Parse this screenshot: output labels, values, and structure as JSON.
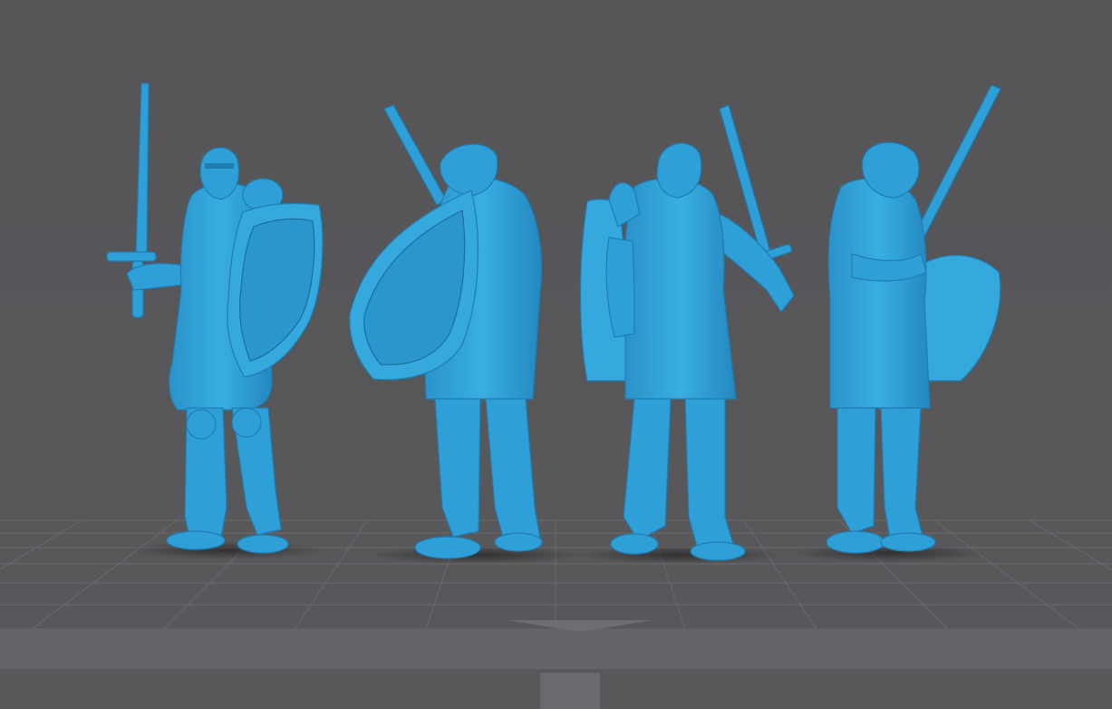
{
  "scene": {
    "background_color": "#565659",
    "floor_color": "#545457",
    "grid_color": "#6d6d72",
    "model_color": "#2f9fd8",
    "model_shade": "#1e7fb4",
    "model_highlight": "#5cc3f0",
    "build_plate_edge_color": "#66666a",
    "build_plate_front_color": "#59595c"
  },
  "models": [
    {
      "name": "knight-front-view",
      "view": "front"
    },
    {
      "name": "knight-left-view",
      "view": "left"
    },
    {
      "name": "knight-back-view",
      "view": "back"
    },
    {
      "name": "knight-right-view",
      "view": "right"
    }
  ]
}
